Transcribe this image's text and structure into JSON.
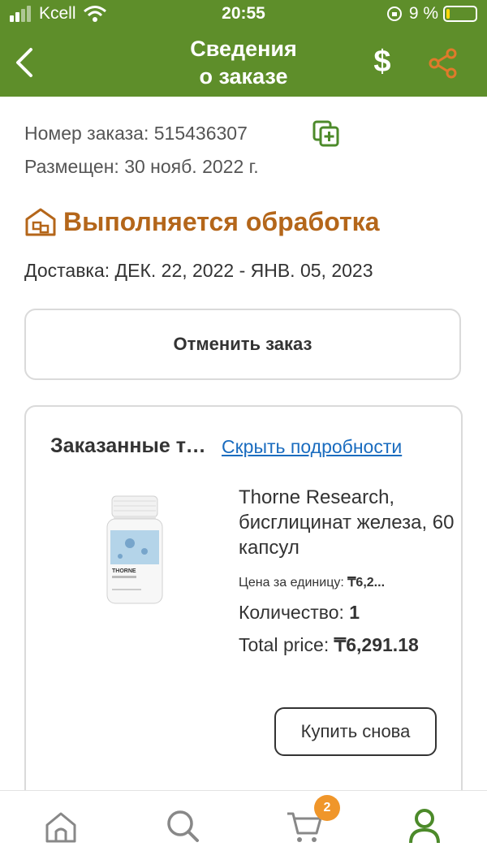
{
  "status_bar": {
    "carrier": "Kcell",
    "time": "20:55",
    "battery_pct": "9 %"
  },
  "header": {
    "title_line1": "Сведения",
    "title_line2": "о заказе",
    "dollar_symbol": "$"
  },
  "order": {
    "number_label": "Номер заказа: 515436307",
    "placed_label": "Размещен: 30 нояб. 2022 г.",
    "status": "Выполняется обработка",
    "delivery": "Доставка: ДЕК. 22, 2022 - ЯНВ. 05, 2023",
    "cancel_label": "Отменить заказ"
  },
  "items_card": {
    "title": "Заказанные товары",
    "hide_link": "Скрыть подробности",
    "product": {
      "brand_on_label": "THORNE",
      "name": "Thorne Research, бисглицинат железа, 60 капсул",
      "unit_price_label": "Цена за единицу: ",
      "unit_price": "₸6,2...",
      "qty_label": "Количество: ",
      "qty": "1",
      "total_label": "Total price: ",
      "total": "₸6,291.18"
    },
    "buy_again": "Купить снова"
  },
  "tabbar": {
    "cart_count": "2"
  },
  "colors": {
    "header_green": "#5e8e2a",
    "status_orange": "#b4661a",
    "link_blue": "#1a6cbf",
    "badge_orange": "#f0962a",
    "share_orange": "#e07a2b"
  }
}
